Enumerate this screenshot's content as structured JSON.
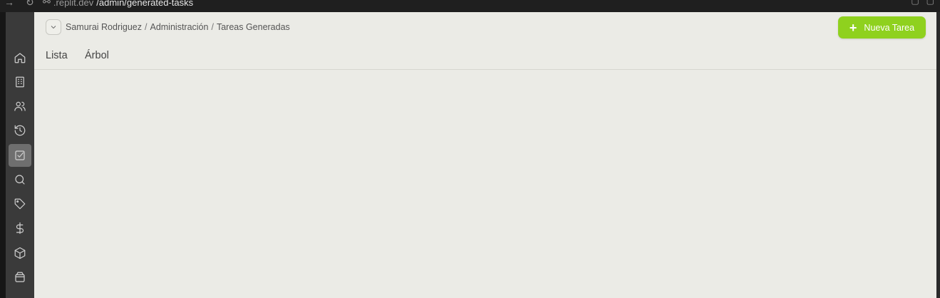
{
  "browser": {
    "url_prefix": ".replit.dev",
    "url_path": "/admin/generated-tasks"
  },
  "breadcrumb": {
    "items": [
      "Samurai Rodriguez",
      "Administración",
      "Tareas Generadas"
    ],
    "separator": "/"
  },
  "actions": {
    "new_task_label": "Nueva Tarea"
  },
  "tabs": [
    {
      "label": "Lista"
    },
    {
      "label": "Árbol"
    }
  ],
  "sidebar": {
    "icons": [
      "home-icon",
      "building-icon",
      "users-icon",
      "history-icon",
      "tasks-icon",
      "search-icon",
      "tag-icon",
      "dollar-icon",
      "package-icon",
      "box-icon"
    ],
    "active": "tasks-icon"
  },
  "colors": {
    "accent": "#8fd11e",
    "sidebar_bg": "#3a3a3a",
    "main_bg": "#ebebe6"
  }
}
